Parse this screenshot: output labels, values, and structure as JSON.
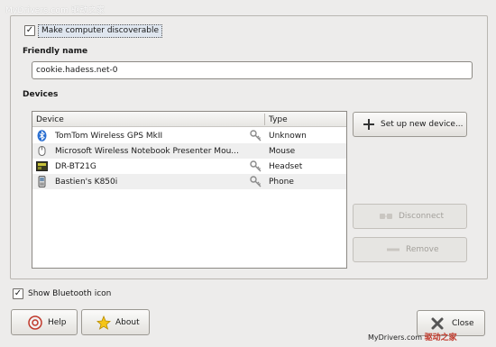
{
  "watermark_top": "MyDrivers.com 驱动之家",
  "watermark_bottom": {
    "site": "MyDrivers.com",
    "cn": "驱动之家"
  },
  "discoverable": {
    "label": "Make computer discoverable",
    "checked": true
  },
  "friendly_name": {
    "title": "Friendly name",
    "value": "cookie.hadess.net-0"
  },
  "devices": {
    "title": "Devices",
    "columns": [
      "Device",
      "Type"
    ],
    "rows": [
      {
        "icon": "bluetooth-icon",
        "name": "TomTom Wireless GPS MkII",
        "type": "Unknown",
        "paired": true
      },
      {
        "icon": "mouse-icon",
        "name": "Microsoft Wireless Notebook Presenter Mou...",
        "type": "Mouse",
        "paired": false
      },
      {
        "icon": "headset-icon",
        "name": "DR-BT21G",
        "type": "Headset",
        "paired": true
      },
      {
        "icon": "phone-icon",
        "name": "Bastien's K850i",
        "type": "Phone",
        "paired": true
      }
    ]
  },
  "buttons": {
    "setup": "Set up new device...",
    "disconnect": "Disconnect",
    "remove": "Remove",
    "help": "Help",
    "about": "About",
    "close": "Close"
  },
  "show_icon": {
    "label": "Show Bluetooth icon",
    "checked": true
  }
}
